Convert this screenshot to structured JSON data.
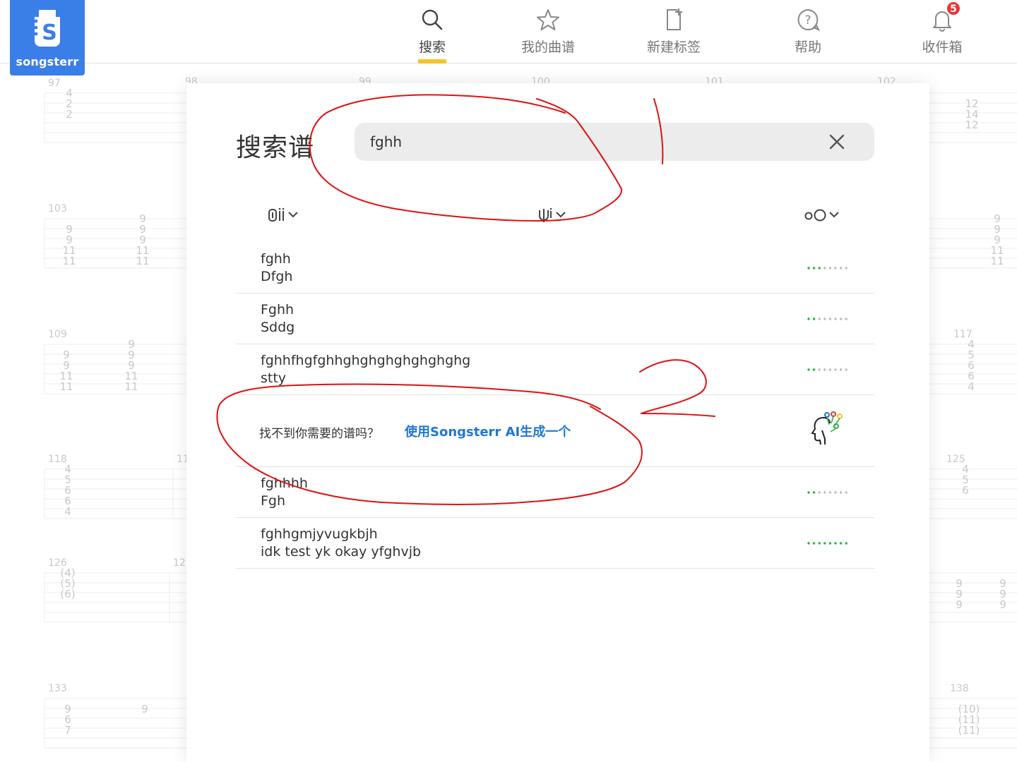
{
  "brand": {
    "name": "songsterr"
  },
  "nav": [
    {
      "label": "搜索",
      "icon": "search-icon",
      "active": true
    },
    {
      "label": "我的曲谱",
      "icon": "star-icon"
    },
    {
      "label": "新建标签",
      "icon": "new-tab-icon"
    },
    {
      "label": "帮助",
      "icon": "help-icon"
    },
    {
      "label": "收件箱",
      "icon": "bell-icon",
      "badge": "5"
    }
  ],
  "background_bars": {
    "top": [
      "97",
      "98",
      "99",
      "100",
      "101",
      "102"
    ],
    "left": [
      "103",
      "109",
      "118",
      "126",
      "133"
    ],
    "right": [
      "117",
      "125",
      "138"
    ],
    "inner": [
      "11",
      "12"
    ]
  },
  "search": {
    "title": "搜索谱",
    "query": "fghh",
    "filters": {
      "instrument": "instrument-filter",
      "tuning": "tuning-filter",
      "difficulty": "difficulty-filter"
    }
  },
  "results": [
    {
      "title": "fghh",
      "artist": "Dfgh",
      "difficulty": 3
    },
    {
      "title": "Fghh",
      "artist": "Sddg",
      "difficulty": 2
    },
    {
      "title": "fghhfhgfghhghghghghghghghg",
      "artist": "stty",
      "difficulty": 2
    },
    {
      "title": "fghhhh",
      "artist": "Fgh",
      "difficulty": 2
    },
    {
      "title": "fghhgmjyvugkbjh",
      "artist": "idk test yk okay yfghvjb",
      "difficulty": 8
    }
  ],
  "ai_prompt": {
    "question": "找不到你需要的谱吗？",
    "link": "使用Songsterr AI生成一个"
  },
  "colors": {
    "brand": "#3a7ee8",
    "accent": "#f7c22a",
    "link": "#1f77d6",
    "difficulty_on": "#2db34a",
    "difficulty_off": "#bdbdbd",
    "annotation": "#e01010"
  }
}
